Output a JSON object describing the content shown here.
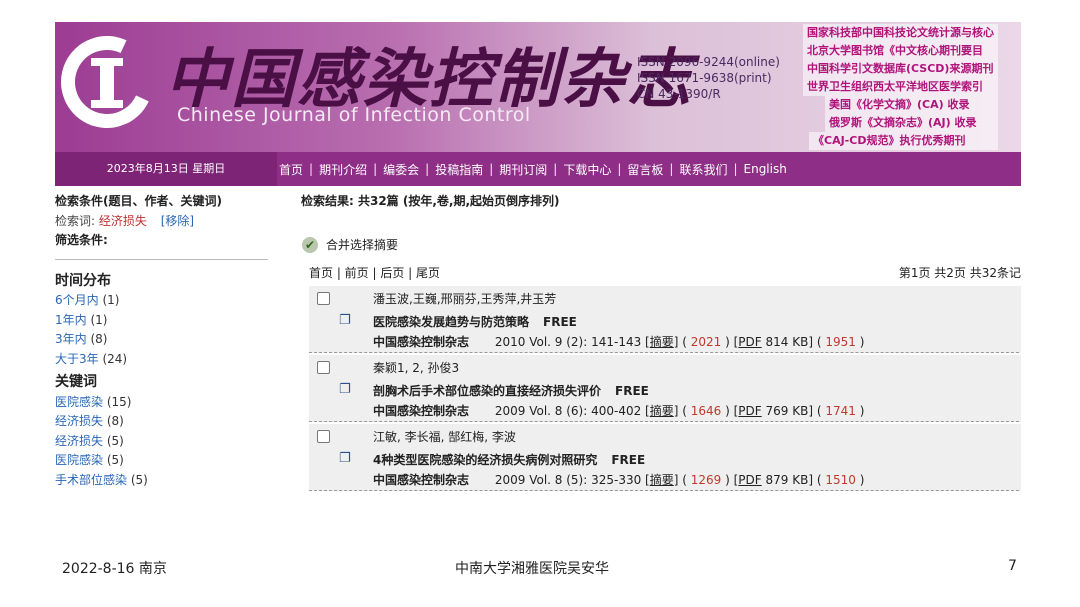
{
  "banner": {
    "cn_title": "中国感染控制杂志",
    "en_title": "Chinese Journal of Infection Control",
    "issn_lines": [
      "ISSN 2096-9244(online)",
      "ISSN 1671-9638(print)",
      "CN 43-1390/R"
    ],
    "index_lines": [
      "国家科技部中国科技论文统计源与核心",
      "北京大学图书馆《中文核心期刊要目",
      "中国科学引文数据库(CSCD)来源期刊",
      "世界卫生组织西太平洋地区医学索引",
      "美国《化学文摘》(CA) 收录",
      "俄罗斯《文摘杂志》(AJ) 收录",
      "《CAJ-CD规范》执行优秀期刊"
    ]
  },
  "nav": {
    "date": "2023年8月13日 星期日",
    "items": [
      "首页",
      "期刊介绍",
      "编委会",
      "投稿指南",
      "期刊订阅",
      "下载中心",
      "留言板",
      "联系我们",
      "English"
    ]
  },
  "left": {
    "criteria_label": "检索条件(题目、作者、关键词)",
    "keyword_label": "检索词:",
    "keyword_value": "经济损失",
    "remove_label": "[移除]",
    "filter_label": "筛选条件:",
    "time_heading": "时间分布",
    "time_items": [
      {
        "label": "6个月内",
        "count": "(1)"
      },
      {
        "label": "1年内",
        "count": "(1)"
      },
      {
        "label": "3年内",
        "count": "(8)"
      },
      {
        "label": "大于3年",
        "count": "(24)"
      }
    ],
    "kw_heading": "关键词",
    "kw_items": [
      {
        "label": "医院感染",
        "count": "(15)"
      },
      {
        "label": "经济损失",
        "count": "(8)"
      },
      {
        "label": "经济损失",
        "count": "(5)"
      },
      {
        "label": "医院感染",
        "count": "(5)"
      },
      {
        "label": "手术部位感染",
        "count": "(5)"
      }
    ]
  },
  "right": {
    "results_summary": "检索结果: 共32篇 (按年,卷,期,起始页倒序排列)",
    "merge_label": "合并选择摘要",
    "pager_links": "首页 | 前页 | 后页 | 尾页",
    "pager_status": "第1页 共2页 共32条记",
    "records": [
      {
        "authors": "潘玉波,王巍,邢丽芬,王秀萍,井玉芳",
        "title": "医院感染发展趋势与防范策略",
        "free": "FREE",
        "journal": "中国感染控制杂志",
        "citation": "2010 Vol. 9 (2): 141-143",
        "abstract_label": "摘要",
        "abstract_count": "2021",
        "pdf_label": "PDF",
        "pdf_size": "814 KB",
        "pdf_count": "1951"
      },
      {
        "authors": "秦颖1, 2, 孙俊3",
        "title": "剖胸术后手术部位感染的直接经济损失评价",
        "free": "FREE",
        "journal": "中国感染控制杂志",
        "citation": "2009 Vol. 8 (6): 400-402",
        "abstract_label": "摘要",
        "abstract_count": "1646",
        "pdf_label": "PDF",
        "pdf_size": "769 KB",
        "pdf_count": "1741"
      },
      {
        "authors": "江敏, 李长福, 郜红梅, 李波",
        "title": "4种类型医院感染的经济损失病例对照研究",
        "free": "FREE",
        "journal": "中国感染控制杂志",
        "citation": "2009 Vol. 8 (5): 325-330",
        "abstract_label": "摘要",
        "abstract_count": "1269",
        "pdf_label": "PDF",
        "pdf_size": "879 KB",
        "pdf_count": "1510"
      }
    ]
  },
  "footer": {
    "date_place": "2022-8-16 南京",
    "author": "中南大学湘雅医院吴安华",
    "page_number": "7"
  },
  "colors": {
    "banner_purple": "#9c3c93",
    "nav_purple": "#8e2e86",
    "link_blue": "#2a66b5",
    "count_red": "#c0392b"
  }
}
